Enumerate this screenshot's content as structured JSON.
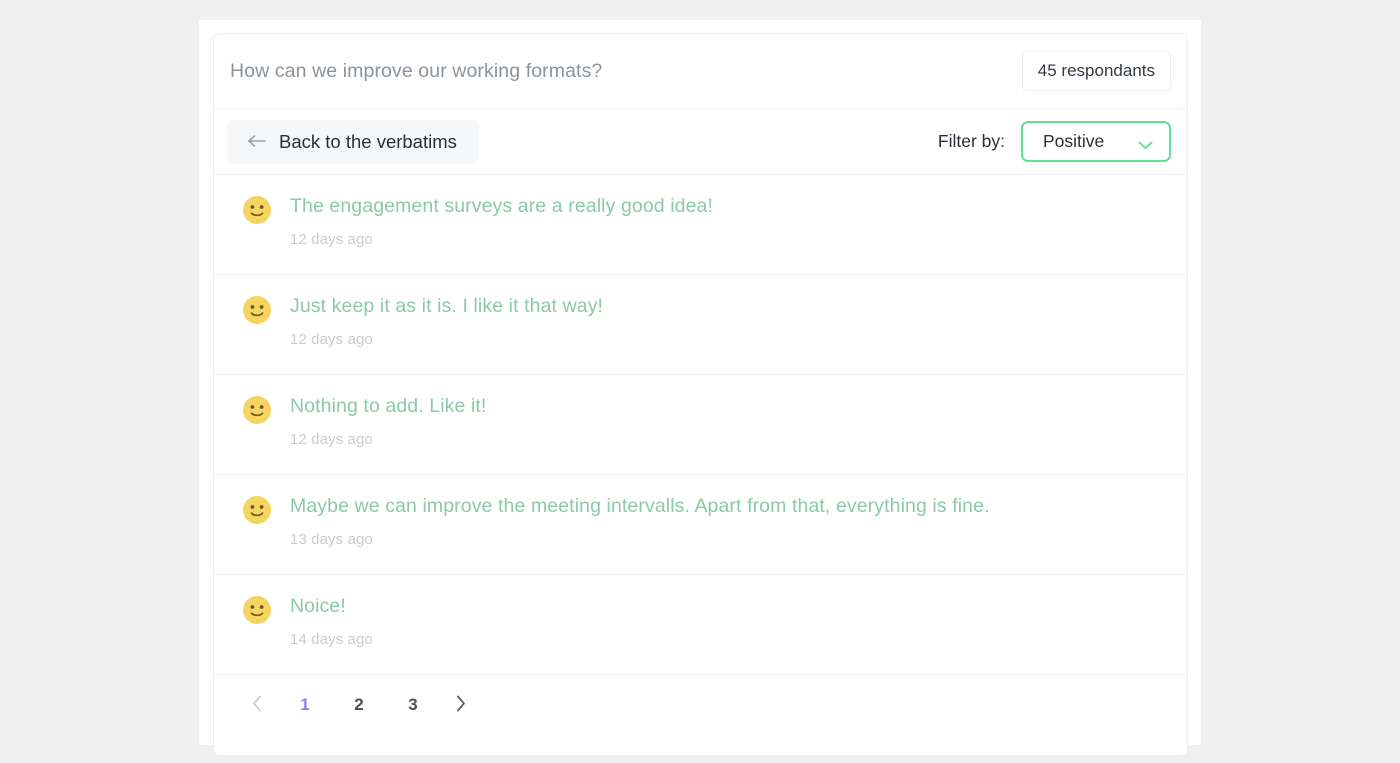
{
  "header": {
    "title": "How can we improve our working formats?",
    "respondants_badge": "45 respondants"
  },
  "toolbar": {
    "back_label": "Back to the verbatims",
    "back_icon": "arrow-left-icon",
    "filter_label": "Filter by:",
    "filter_value": "Positive",
    "filter_chevron_icon": "chevron-down-icon",
    "filter_options": [
      "Positive"
    ]
  },
  "verbatims": [
    {
      "sentiment_icon": "smiley-face-icon",
      "text": "The engagement surveys are a really good idea!",
      "date": "12 days ago"
    },
    {
      "sentiment_icon": "smiley-face-icon",
      "text": "Just keep it as it is. I like it that way!",
      "date": "12 days ago"
    },
    {
      "sentiment_icon": "smiley-face-icon",
      "text": "Nothing to add. Like it!",
      "date": "12 days ago"
    },
    {
      "sentiment_icon": "smiley-face-icon",
      "text": "Maybe we can improve the meeting intervalls. Apart from that, everything is fine.",
      "date": "13 days ago"
    },
    {
      "sentiment_icon": "smiley-face-icon",
      "text": "Noice!",
      "date": "14 days ago"
    }
  ],
  "pagination": {
    "prev_icon": "chevron-left-icon",
    "next_icon": "chevron-right-icon",
    "pages": [
      "1",
      "2",
      "3"
    ],
    "active_page": "1"
  },
  "colors": {
    "page_background": "#f0f0f0",
    "card_background": "#ffffff",
    "card_border": "#eceef2",
    "divider": "#edeff3",
    "title_text": "#8d939c",
    "body_text": "#2b2f36",
    "positive_green": "#8cc9a7",
    "accent_green_border": "#64e096",
    "date_gray": "#c8cccf",
    "pagination_active": "#8f7cf7",
    "back_button_bg": "#f6f7f8",
    "emoji_yellow": "#f4d35e"
  }
}
